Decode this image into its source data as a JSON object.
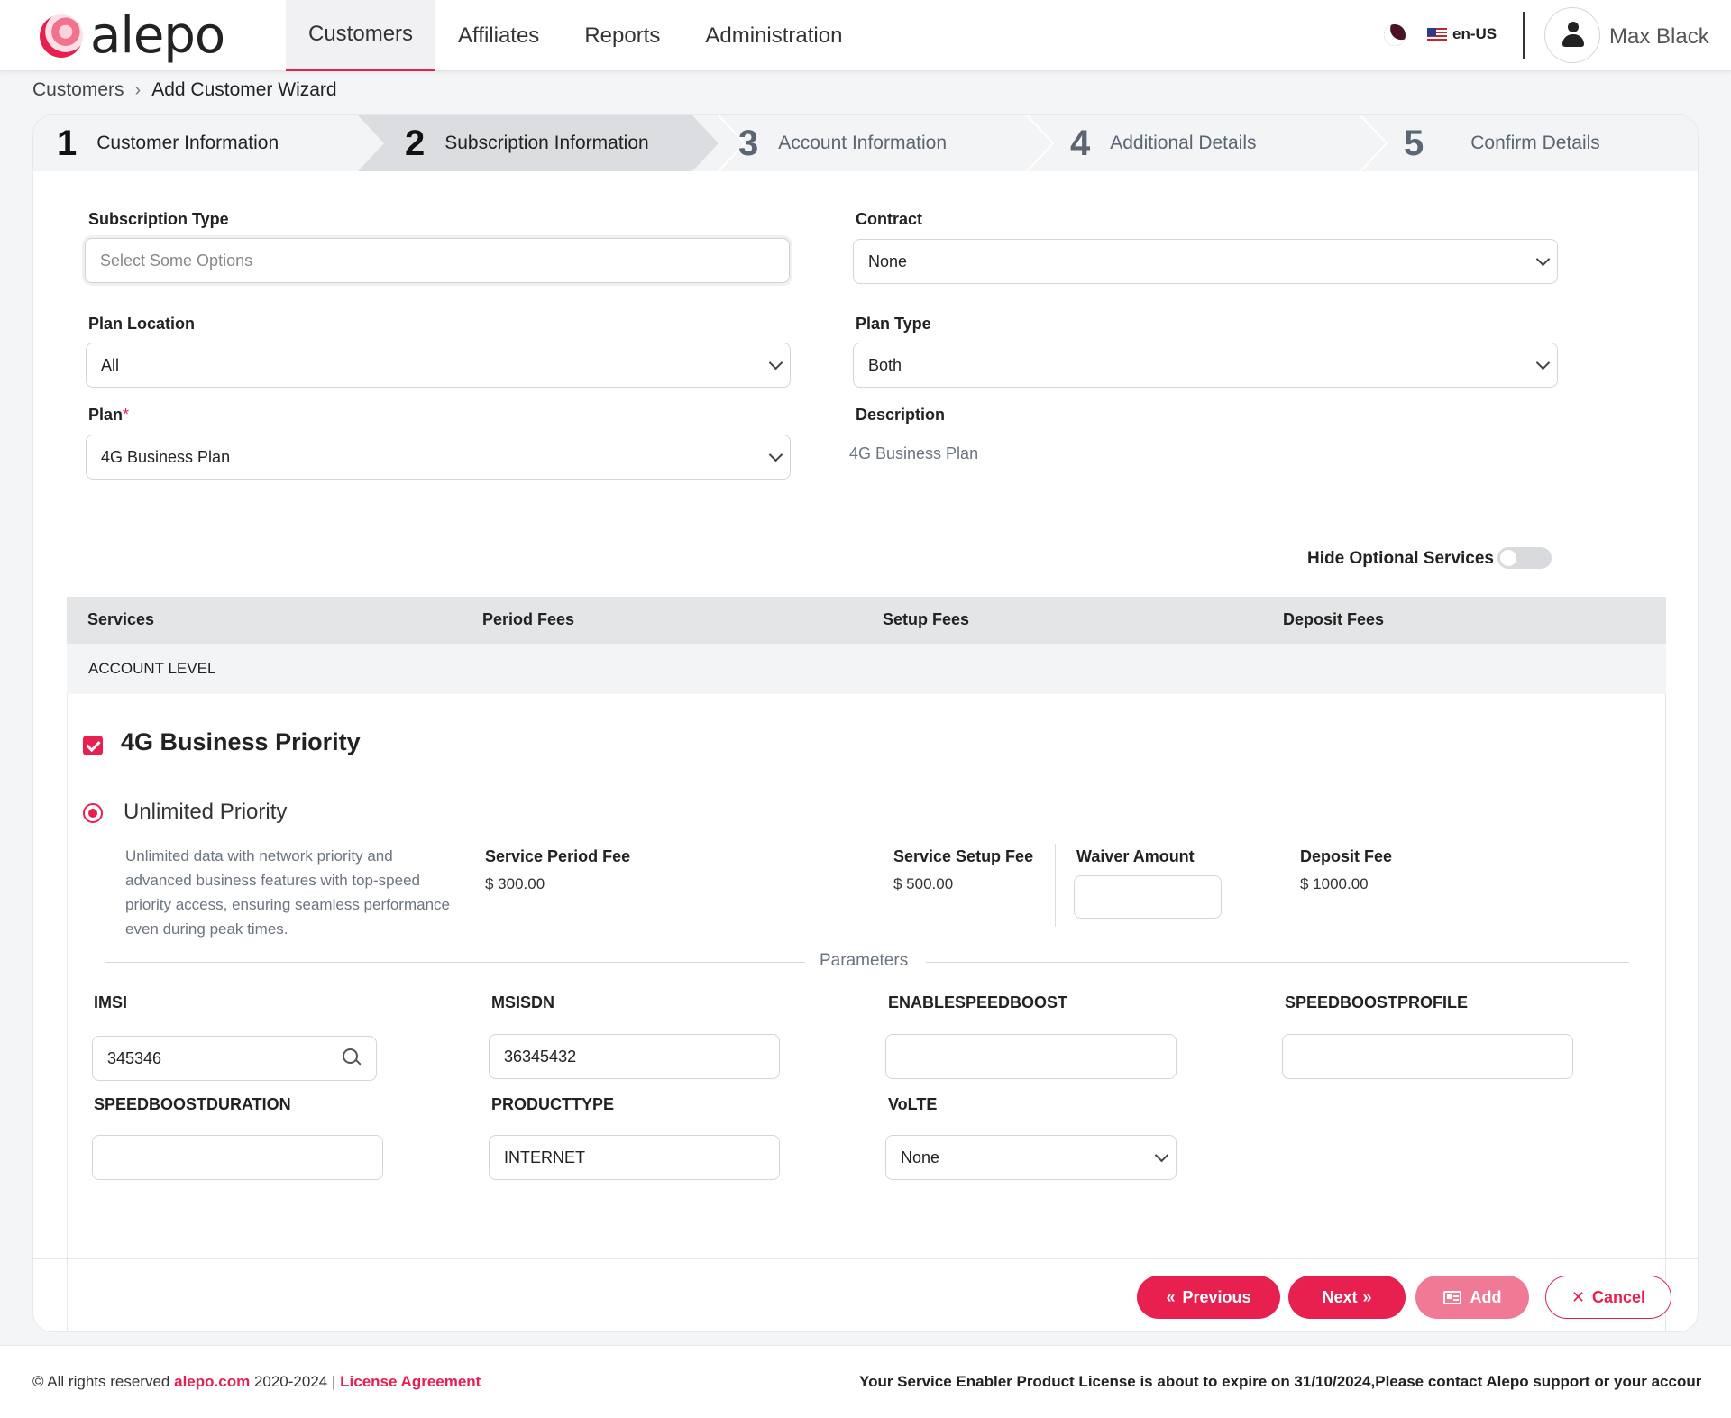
{
  "app": {
    "logo_text": "alepo"
  },
  "nav": {
    "items": [
      {
        "label": "Customers",
        "active": true
      },
      {
        "label": "Affiliates"
      },
      {
        "label": "Reports"
      },
      {
        "label": "Administration"
      }
    ],
    "language": "en-US",
    "user_name": "Max Black"
  },
  "breadcrumb": {
    "root": "Customers",
    "current": "Add Customer Wizard"
  },
  "steps": [
    {
      "num": "1",
      "label": "Customer Information"
    },
    {
      "num": "2",
      "label": "Subscription Information"
    },
    {
      "num": "3",
      "label": "Account Information"
    },
    {
      "num": "4",
      "label": "Additional Details"
    },
    {
      "num": "5",
      "label": "Confirm Details"
    }
  ],
  "form": {
    "subscription_type": {
      "label": "Subscription Type",
      "placeholder": "Select Some Options"
    },
    "contract": {
      "label": "Contract",
      "value": "None"
    },
    "plan_location": {
      "label": "Plan Location",
      "value": "All"
    },
    "plan_type": {
      "label": "Plan Type",
      "value": "Both"
    },
    "plan": {
      "label": "Plan",
      "required_mark": "*",
      "value": "4G Business Plan"
    },
    "description": {
      "label": "Description",
      "value": "4G Business Plan"
    }
  },
  "hide_optional": {
    "label": "Hide Optional Services",
    "enabled": false
  },
  "table": {
    "headers": [
      "Services",
      "Period Fees",
      "Setup Fees",
      "Deposit Fees"
    ],
    "group": "ACCOUNT LEVEL"
  },
  "service": {
    "title": "4G Business Priority",
    "checked": true,
    "option": {
      "title": "Unlimited Priority",
      "description": "Unlimited data with network priority and advanced business features with top-speed priority access, ensuring seamless performance even during peak times."
    },
    "fees": {
      "period_label": "Service Period Fee",
      "period_value": "$ 300.00",
      "setup_label": "Service Setup Fee",
      "setup_value": "$ 500.00",
      "waiver_label": "Waiver Amount",
      "waiver_value": "",
      "deposit_label": "Deposit Fee",
      "deposit_value": "$ 1000.00"
    },
    "params_label": "Parameters",
    "params": {
      "imsi": {
        "label": "IMSI",
        "value": "345346"
      },
      "msisdn": {
        "label": "MSISDN",
        "value": "36345432"
      },
      "enablespeedboost": {
        "label": "ENABLESPEEDBOOST",
        "value": ""
      },
      "speedboostprofile": {
        "label": "SPEEDBOOSTPROFILE",
        "value": ""
      },
      "speedboostduration": {
        "label": "SPEEDBOOSTDURATION",
        "value": ""
      },
      "producttype": {
        "label": "PRODUCTTYPE",
        "value": "INTERNET"
      },
      "volte": {
        "label": "VoLTE",
        "value": "None"
      }
    }
  },
  "buttons": {
    "previous": "Previous",
    "next": "Next",
    "add": "Add",
    "cancel": "Cancel"
  },
  "colors": {
    "accent": "#e8204f",
    "accent_light": "#f07a95"
  },
  "footer": {
    "copyright_prefix": "© All rights reserved",
    "site": "alepo.com",
    "years": "2020-2024",
    "separator": "|",
    "license": "License Agreement",
    "notice": "Your Service Enabler Product License is about to expire on 31/10/2024,Please contact Alepo support or your account manager"
  }
}
